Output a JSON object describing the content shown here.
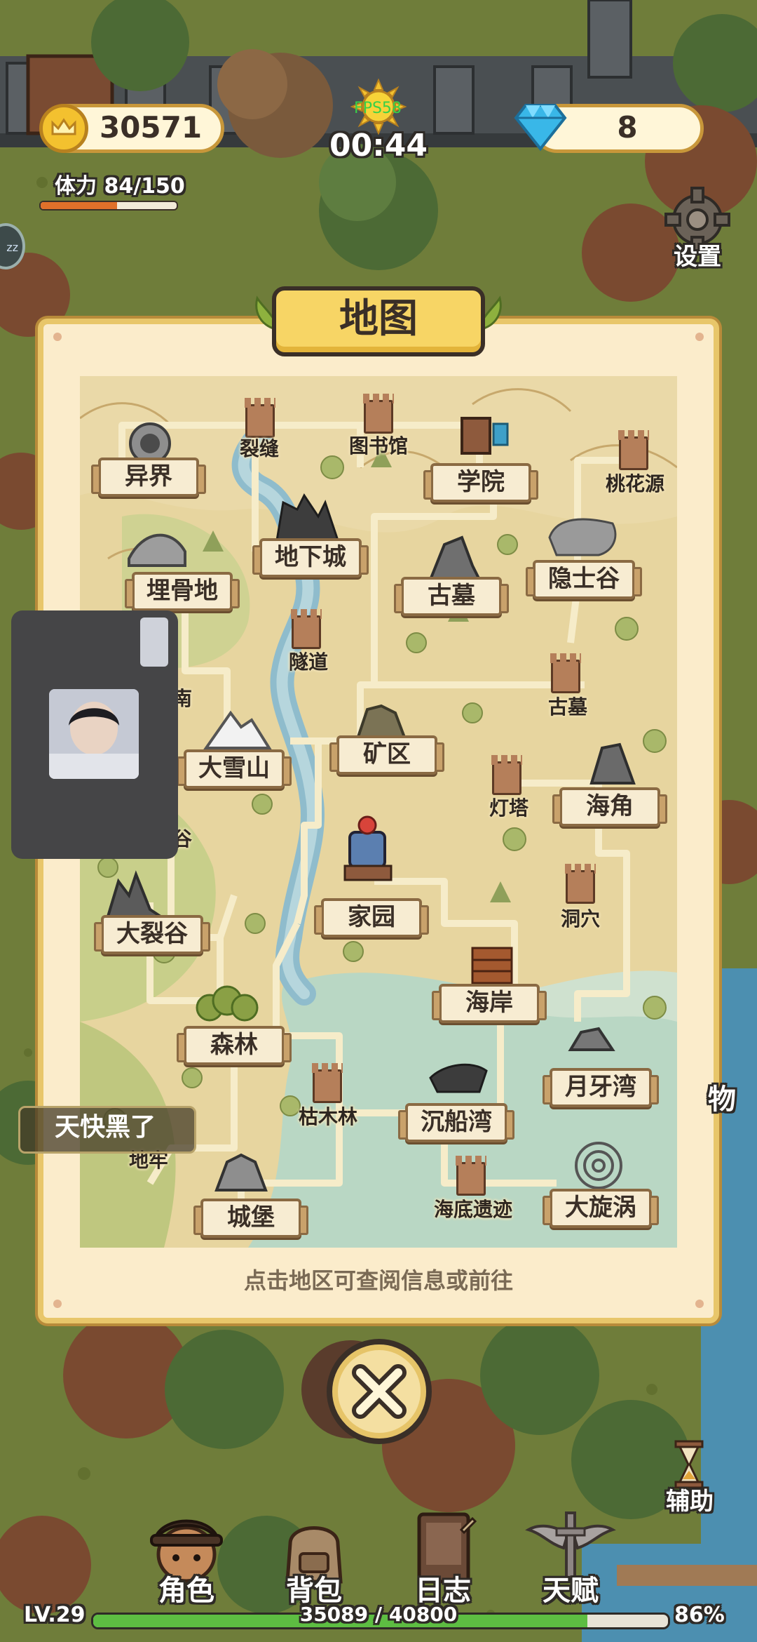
{
  "hud": {
    "gold": "30571",
    "gems": "8",
    "timer": "00:44",
    "fps": "FPS58",
    "stamina_label": "体力 84/150",
    "stamina_fraction": 0.56,
    "settings_label": "设置"
  },
  "map_panel": {
    "title": "地图",
    "hint": "点击地区可查阅信息或前往",
    "locations": {
      "yijie": "异界",
      "liefeng": "裂缝",
      "tushuguan": "图书馆",
      "xueyuan": "学院",
      "taohuayuan": "桃花源",
      "maigudi": "埋骨地",
      "dixiacheng": "地下城",
      "gumu": "古墓",
      "yinshigu": "隐士谷",
      "suidao": "隧道",
      "gumu2": "古墓",
      "partial_left": "南",
      "daxueshan": "大雪山",
      "kuangqu": "矿区",
      "dengta": "灯塔",
      "haijiao": "海角",
      "partial_left2": "谷",
      "daliegu": "大裂谷",
      "jiayuan": "家园",
      "dongxue": "洞穴",
      "haian": "海岸",
      "senlin": "森林",
      "yueyawan": "月牙湾",
      "kumulin": "枯木林",
      "chenchuanwan": "沉船湾",
      "dilao": "地牢",
      "chengbao": "城堡",
      "haidiyiji": "海底遗迹",
      "daxuanwo": "大旋涡"
    }
  },
  "toast": "天快黑了",
  "side": {
    "assist_label": "辅助",
    "right_partial": "物"
  },
  "bottom_nav": {
    "items": [
      "角色",
      "背包",
      "日志",
      "天赋"
    ]
  },
  "xp": {
    "level": "LV.29",
    "progress": "35089 / 40800",
    "percent": "86%",
    "fraction": 0.86
  },
  "colors": {
    "panel": "#fbeccb",
    "panel_border": "#e8c66a",
    "gold": "#f3c12f",
    "gem": "#39b7e8"
  }
}
